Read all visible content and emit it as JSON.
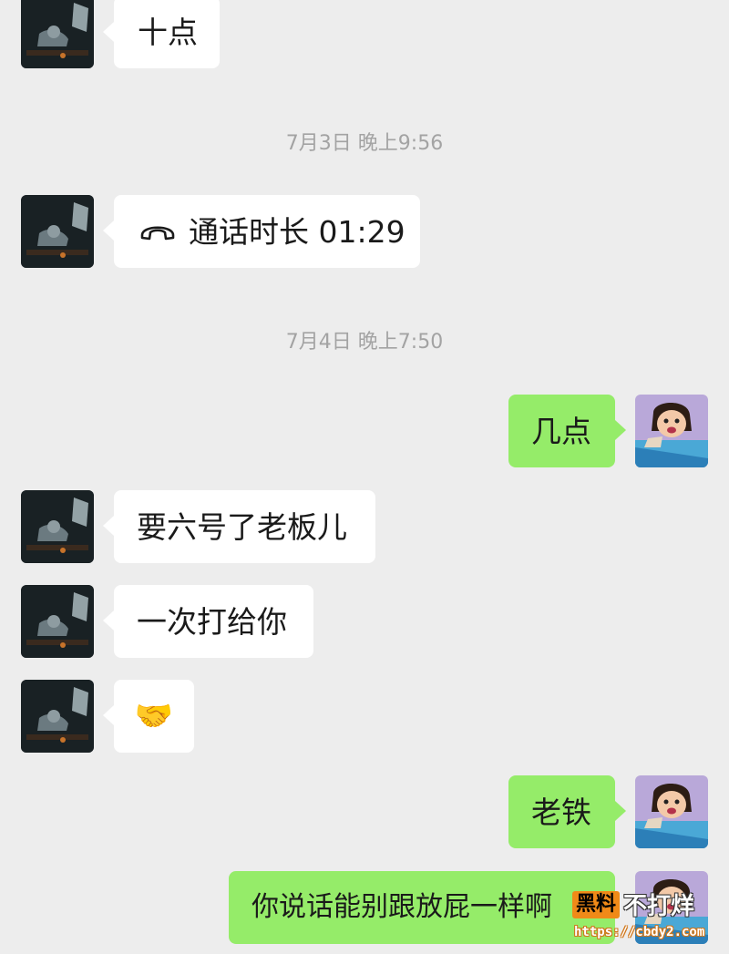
{
  "chat": {
    "msg1": "十点",
    "time1": "7月3日 晚上9:56",
    "call_label": "通话时长 01:29",
    "time2": "7月4日 晚上7:50",
    "msg2": "几点",
    "msg3": "要六号了老板儿",
    "msg4": "一次打给你",
    "msg5_emoji": "🤝",
    "msg6": "老铁",
    "msg7": "你说话能别跟放屁一样啊"
  },
  "watermark": {
    "box_text": "黑料",
    "side_text": "不打烊",
    "url": "https://cbdy2.com"
  },
  "colors": {
    "background": "#ededed",
    "incoming_bubble": "#ffffff",
    "outgoing_bubble": "#95ec69",
    "timestamp": "#a3a3a3",
    "watermark_orange": "#f08a18"
  },
  "icons": {
    "call": "phone-hangup-icon",
    "contact_avatar": "dark-room-avatar",
    "self_avatar": "cartoon-sleeping-avatar"
  }
}
